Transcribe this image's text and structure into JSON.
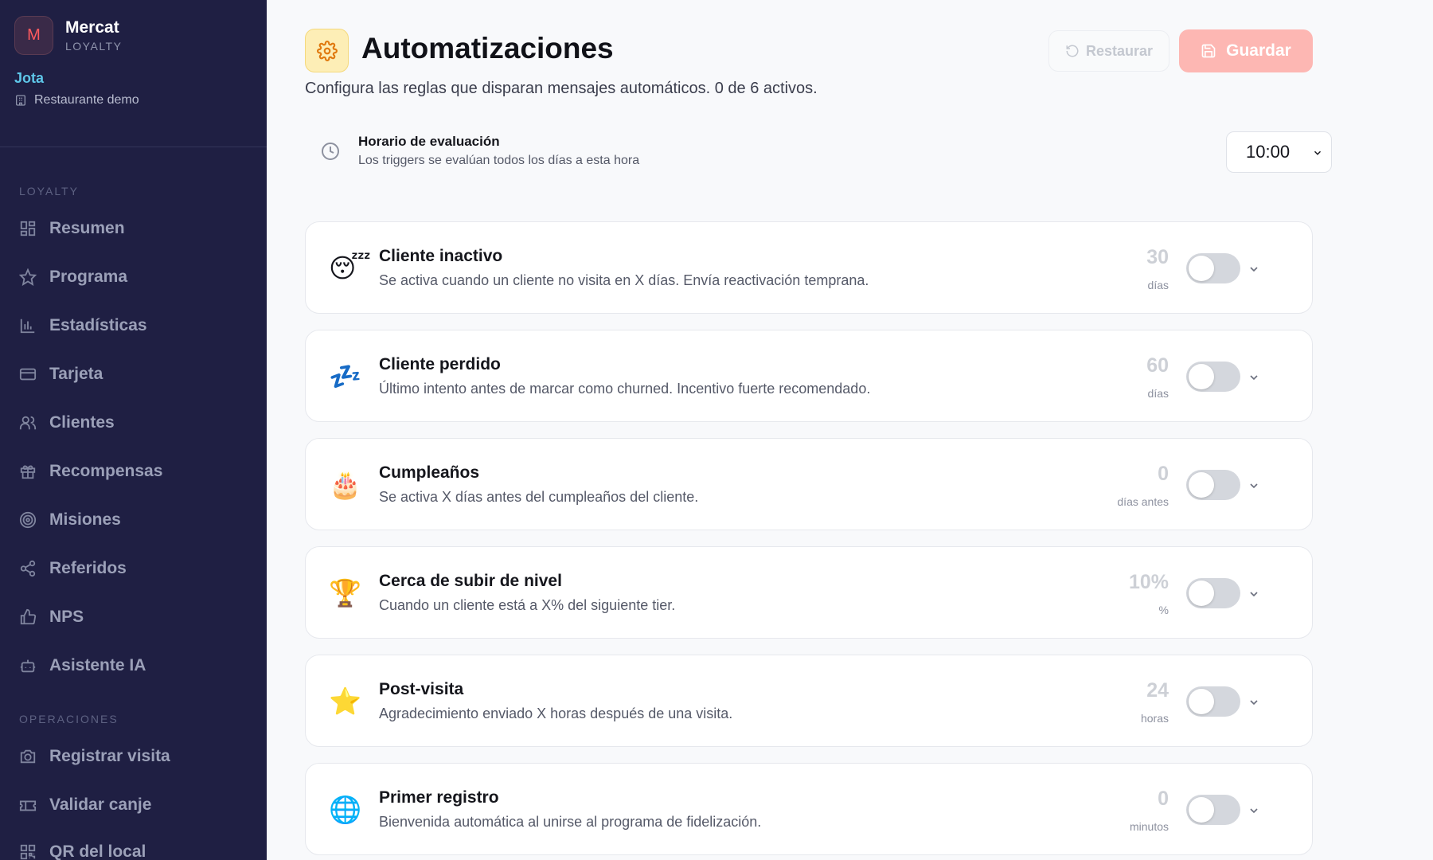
{
  "brand": {
    "initial": "M",
    "name": "Mercat",
    "subtitle": "LOYALTY"
  },
  "user": {
    "name": "Jota",
    "location": "Restaurante demo"
  },
  "sidebar": {
    "sections": [
      {
        "label": "LOYALTY"
      },
      {
        "label": "OPERACIONES"
      }
    ],
    "items": [
      {
        "label": "Resumen",
        "icon": "grid-icon"
      },
      {
        "label": "Programa",
        "icon": "star-icon"
      },
      {
        "label": "Estadísticas",
        "icon": "bar-chart-icon"
      },
      {
        "label": "Tarjeta",
        "icon": "card-icon"
      },
      {
        "label": "Clientes",
        "icon": "users-icon"
      },
      {
        "label": "Recompensas",
        "icon": "gift-icon"
      },
      {
        "label": "Misiones",
        "icon": "target-icon"
      },
      {
        "label": "Referidos",
        "icon": "share-icon"
      },
      {
        "label": "NPS",
        "icon": "thumbs-up-icon"
      },
      {
        "label": "Asistente IA",
        "icon": "bot-icon"
      },
      {
        "label": "Registrar visita",
        "icon": "camera-icon"
      },
      {
        "label": "Validar canje",
        "icon": "ticket-icon"
      },
      {
        "label": "QR del local",
        "icon": "qr-icon"
      }
    ]
  },
  "header": {
    "title": "Automatizaciones",
    "subtitle": "Configura las reglas que disparan mensajes automáticos. 0 de 6 activos.",
    "restore_label": "Restaurar",
    "save_label": "Guardar"
  },
  "schedule": {
    "title": "Horario de evaluación",
    "description": "Los triggers se evalúan todos los días a esta hora",
    "time": "10:00"
  },
  "triggers": [
    {
      "emoji": "😴",
      "title": "Cliente inactivo",
      "description": "Se activa cuando un cliente no visita en X días. Envía reactivación temprana.",
      "value": "30",
      "unit": "días",
      "enabled": false
    },
    {
      "emoji": "💤",
      "title": "Cliente perdido",
      "description": "Último intento antes de marcar como churned. Incentivo fuerte recomendado.",
      "value": "60",
      "unit": "días",
      "enabled": false
    },
    {
      "emoji": "🎂",
      "title": "Cumpleaños",
      "description": "Se activa X días antes del cumpleaños del cliente.",
      "value": "0",
      "unit": "días antes",
      "enabled": false
    },
    {
      "emoji": "🏆",
      "title": "Cerca de subir de nivel",
      "description": "Cuando un cliente está a X% del siguiente tier.",
      "value": "10%",
      "unit": "%",
      "enabled": false
    },
    {
      "emoji": "⭐",
      "title": "Post-visita",
      "description": "Agradecimiento enviado X horas después de una visita.",
      "value": "24",
      "unit": "horas",
      "enabled": false
    },
    {
      "emoji": "🌐",
      "title": "Primer registro",
      "description": "Bienvenida automática al unirse al programa de fidelización.",
      "value": "0",
      "unit": "minutos",
      "enabled": false
    }
  ],
  "colors": {
    "sidebar_bg": "#1f1f43",
    "accent": "#ff5a5f",
    "user_accent": "#5ec6e8",
    "icon_bg": "#fdeeb6"
  }
}
